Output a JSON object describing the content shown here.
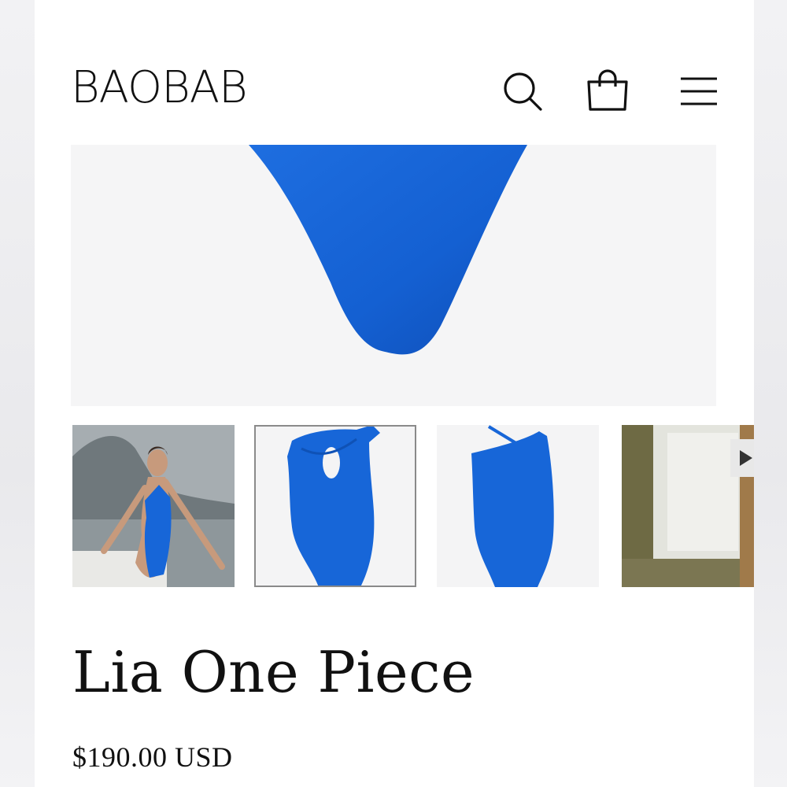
{
  "header": {
    "logo": "BAOBAB",
    "icons": [
      "search-icon",
      "shopping-bag-icon",
      "hamburger-menu-icon"
    ]
  },
  "gallery": {
    "main_image": "swimsuit-bottom-closeup",
    "thumbnails": [
      {
        "name": "model-wearing-swimsuit",
        "selected": false
      },
      {
        "name": "swimsuit-front-view",
        "selected": true
      },
      {
        "name": "swimsuit-back-view",
        "selected": false
      },
      {
        "name": "video-thumbnail",
        "selected": false,
        "has_play_button": true
      }
    ]
  },
  "product": {
    "title": "Lia One Piece",
    "price": "$190.00 USD"
  },
  "colors": {
    "swimsuit_blue": "#1664d6",
    "text": "#111111",
    "image_bg": "#f5f5f6"
  }
}
